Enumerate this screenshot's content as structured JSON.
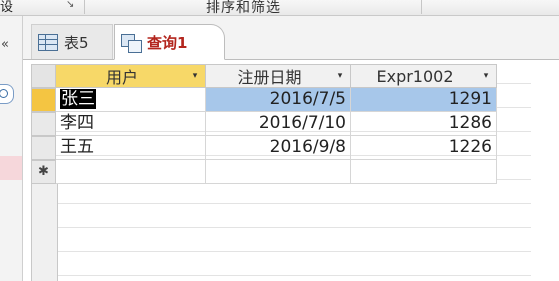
{
  "ribbon": {
    "left_fragment": "设",
    "launcher": "↘",
    "group_label": "排序和筛选"
  },
  "navpane": {
    "close_glyph": "«"
  },
  "tabs": [
    {
      "label": "表5",
      "icon": "table-icon",
      "active": false
    },
    {
      "label": "查询1",
      "icon": "query-icon",
      "active": true
    }
  ],
  "datasheet": {
    "columns": [
      {
        "label": "用户",
        "dropdown": "▾"
      },
      {
        "label": "注册日期",
        "dropdown": "▾"
      },
      {
        "label": "Expr1002",
        "dropdown": "▾"
      }
    ],
    "rows": [
      {
        "user": "张三",
        "date": "2016/7/5",
        "expr": "1291"
      },
      {
        "user": "李四",
        "date": "2016/7/10",
        "expr": "1286"
      },
      {
        "user": "王五",
        "date": "2016/9/8",
        "expr": "1226"
      }
    ],
    "new_row_marker": "✱"
  },
  "colors": {
    "active_tab_text": "#b3261e",
    "current_record_selector": "#f4c542",
    "selected_cell": "#a7c7ea"
  }
}
